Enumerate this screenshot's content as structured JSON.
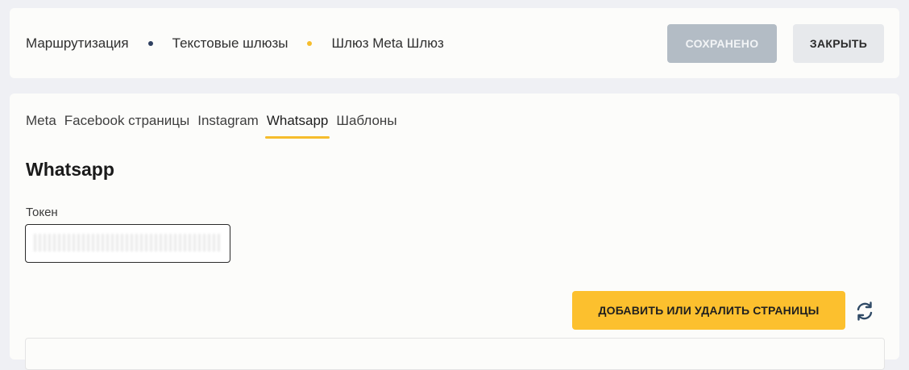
{
  "header": {
    "breadcrumbs": [
      {
        "label": "Маршрутизация",
        "dot_color": "#2f4060"
      },
      {
        "label": "Текстовые шлюзы",
        "dot_color": "#f6bd2c"
      },
      {
        "label": "Шлюз Meta Шлюз"
      }
    ],
    "saved_label": "СОХРАНЕНО",
    "close_label": "ЗАКРЫТЬ"
  },
  "tabs": [
    "Meta",
    "Facebook страницы",
    "Instagram",
    "Whatsapp",
    "Шаблоны"
  ],
  "active_tab": "Whatsapp",
  "section": {
    "title": "Whatsapp",
    "token_label": "Токен",
    "token_value": ""
  },
  "actions": {
    "add_remove_pages_label": "ДОБАВИТЬ ИЛИ УДАЛИТЬ СТРАНИЦЫ",
    "refresh_icon": "refresh-icon"
  },
  "colors": {
    "accent": "#fcc02e",
    "tab_underline": "#f6bd2c",
    "saved_button": "#b3bcc5",
    "close_button": "#e7e9ec",
    "refresh_icon": "#2f4a66"
  }
}
